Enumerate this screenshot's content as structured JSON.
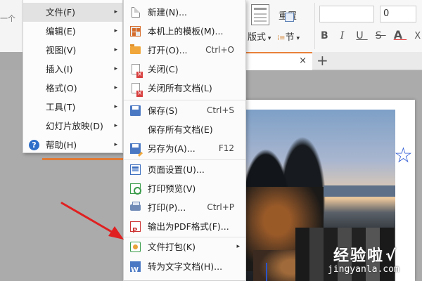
{
  "background": {
    "left_edge_text": "一个",
    "ribbon": {
      "reset_label": "重置",
      "layout_label": "版式",
      "section_label": "节",
      "font_size_value": "0",
      "format_buttons": [
        "B",
        "I",
        "U",
        "S",
        "A",
        "X"
      ]
    },
    "tab": {
      "close_glyph": "×",
      "add_glyph": "+"
    },
    "watermark": {
      "logo": "经验啦",
      "check": "√",
      "url": "jingyanla.com"
    }
  },
  "main_menu": {
    "items": [
      {
        "label": "文件(F)",
        "has_submenu": true,
        "active": true
      },
      {
        "label": "编辑(E)",
        "has_submenu": true
      },
      {
        "label": "视图(V)",
        "has_submenu": true
      },
      {
        "label": "插入(I)",
        "has_submenu": true
      },
      {
        "label": "格式(O)",
        "has_submenu": true
      },
      {
        "label": "工具(T)",
        "has_submenu": true
      },
      {
        "label": "幻灯片放映(D)",
        "has_submenu": true
      },
      {
        "label": "帮助(H)",
        "has_submenu": true,
        "icon": "help-icon"
      }
    ],
    "arrow_glyph": "▸",
    "help_glyph": "?"
  },
  "file_menu": {
    "items": [
      {
        "label": "新建(N)...",
        "icon": "new-file-icon"
      },
      {
        "label": "本机上的模板(M)...",
        "icon": "template-icon"
      },
      {
        "label": "打开(O)...",
        "shortcut": "Ctrl+O",
        "icon": "folder-open-icon"
      },
      {
        "label": "关闭(C)",
        "icon": "close-doc-icon"
      },
      {
        "label": "关闭所有文档(L)",
        "icon": "close-all-icon"
      },
      {
        "label": "保存(S)",
        "shortcut": "Ctrl+S",
        "icon": "save-icon"
      },
      {
        "label": "保存所有文档(E)"
      },
      {
        "label": "另存为(A)...",
        "shortcut": "F12",
        "icon": "save-as-icon"
      },
      {
        "label": "页面设置(U)...",
        "icon": "page-setup-icon"
      },
      {
        "label": "打印预览(V)",
        "icon": "print-preview-icon"
      },
      {
        "label": "打印(P)...",
        "shortcut": "Ctrl+P",
        "icon": "printer-icon"
      },
      {
        "label": "输出为PDF格式(F)...",
        "icon": "pdf-icon"
      },
      {
        "label": "文件打包(K)",
        "has_submenu": true,
        "icon": "package-icon"
      },
      {
        "label": "转为文字文档(H)...",
        "icon": "word-doc-icon"
      }
    ],
    "arrow_glyph": "▸"
  },
  "colors": {
    "accent_orange": "#e07a36",
    "arrow_red": "#e02020",
    "menu_bg": "#fbfbfb",
    "active_bg": "#e2e2e2"
  }
}
